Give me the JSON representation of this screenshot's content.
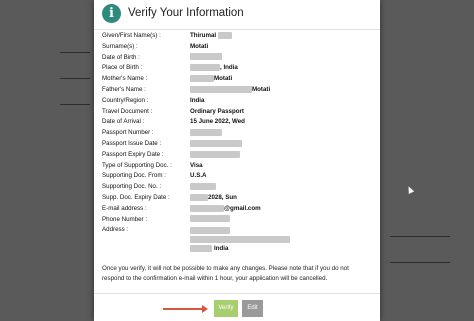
{
  "dialog": {
    "title": "Verify Your Information",
    "icon": "info-icon",
    "accent_color": "#2f8a7e",
    "rows": [
      {
        "label": "Given/First Name(s)",
        "value": "Thirumal",
        "redact": 14
      },
      {
        "label": "Surname(s)",
        "value": "Motati",
        "redact": 0
      },
      {
        "label": "Date of Birth",
        "value": "",
        "redact": 32
      },
      {
        "label": "Place of Birth",
        "value": ", India",
        "redact": 30
      },
      {
        "label": "Mother's Name",
        "value": "Motati",
        "redact": 24
      },
      {
        "label": "Father's Name",
        "value": "Motati",
        "redact": 62
      },
      {
        "label": "Country/Region",
        "value": "India",
        "redact": 0
      },
      {
        "label": "Travel Document",
        "value": "Ordinary Passport",
        "redact": 0
      },
      {
        "label": "Date of Arrival",
        "value": "15 June 2022, Wed",
        "redact": 0
      },
      {
        "label": "Passport Number",
        "value": "",
        "redact": 32
      },
      {
        "label": "Passport Issue Date",
        "value": "",
        "redact": 52
      },
      {
        "label": "Passport Expiry Date",
        "value": "",
        "redact": 50
      },
      {
        "label": "Type of Supporting Doc.",
        "value": "Visa",
        "redact": 0
      },
      {
        "label": "Supporting Doc. From",
        "value": "U.S.A",
        "redact": 0
      },
      {
        "label": "Supporting Doc. No.",
        "value": "",
        "redact": 26
      },
      {
        "label": "Supp. Doc. Expiry Date",
        "value": "2028, Sun",
        "redact": 18
      },
      {
        "label": "E-mail address",
        "value": "@gmail.com",
        "redact": 34
      },
      {
        "label": "Phone Number",
        "value": "",
        "redact": 40
      }
    ],
    "address": {
      "label": "Address",
      "last_line": "India"
    },
    "notice": "Once you verify, it will not be possible to make any changes. Please note that if you do not respond to the confirmation e-mail within 1 hour, your application will be cancelled.",
    "verify_label": "Verify",
    "edit_label": "Edit",
    "colors": {
      "verify_button": "#a8cf6f",
      "edit_button": "#9a9a9a",
      "arrow": "#d9553e"
    }
  }
}
